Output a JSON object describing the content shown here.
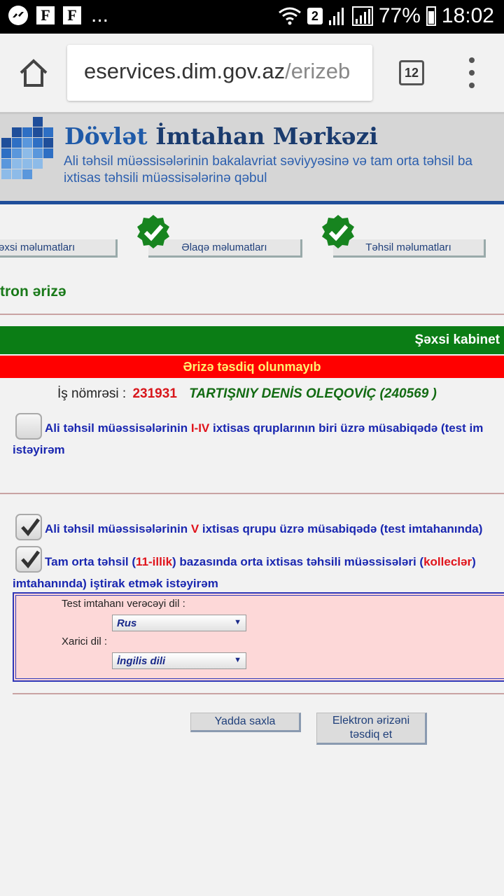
{
  "status_bar": {
    "notification_icons": [
      "messenger-icon",
      "flipboard-icon",
      "flipboard-icon"
    ],
    "more": "...",
    "sim_badge": "2",
    "battery": "77%",
    "time": "18:02"
  },
  "browser": {
    "url_host": "eservices.dim.gov.az",
    "url_path": "/erizeb",
    "tab_count": "12"
  },
  "banner": {
    "title_first": "Dövlət",
    "title_rest": " İmtahan Mərkəzi",
    "subtitle_line1": "Ali təhsil müəssisələrinin bakalavriat səviyyəsinə və tam orta təhsil ba",
    "subtitle_line2": "ixtisas təhsili müəssisələrinə qəbul",
    "logo_colors": [
      "#1f4e9a",
      "#2e6fc4",
      "#5a97dc",
      "#8dbbe8"
    ]
  },
  "steps": [
    {
      "label": "əxsi məlumatları",
      "done": false
    },
    {
      "label": "Əlaqə məlumatları",
      "done": true
    },
    {
      "label": "Təhsil məlumatları",
      "done": true
    }
  ],
  "section_title": "tron ərizə",
  "cabinet_link": "Şəxsi kabinet",
  "warning": "Ərizə təsdiq olunmayıb",
  "application": {
    "label": "İş nömrəsi :",
    "number": "231931",
    "name": "TARTIŞNIY DENİS OLEQOVİÇ (240569 )"
  },
  "option1": {
    "checked": false,
    "prefix": "Ali təhsil müəssisələrinin ",
    "highlight": "I-IV",
    "suffix": " ixtisas qruplarının biri üzrə müsabiqədə (test im",
    "line2": "istəyirəm"
  },
  "option2": {
    "checked": true,
    "prefix": "Ali təhsil müəssisələrinin ",
    "highlight": "V",
    "suffix": " ixtisas qrupu üzrə müsabiqədə (test imtahanında)"
  },
  "option3": {
    "checked": true,
    "prefix": "Tam orta təhsil (",
    "highlight1": "11-illik",
    "middle": ") bazasında orta ixtisas təhsili müəssisələri (",
    "highlight2": "kolleclər",
    "suffix": ")",
    "line2": "imtahanında) iştirak etmək istəyirəm"
  },
  "languages": {
    "test_label": "Test imtahanı verəcəyi dil :",
    "test_value": "Rus",
    "foreign_label": "Xarici dil :",
    "foreign_value": "İngilis dili"
  },
  "buttons": {
    "save": "Yadda saxla",
    "confirm_line1": "Elektron ərizəni",
    "confirm_line2": "təsdiq et"
  },
  "colors": {
    "cabinet_green": "#0b7d15",
    "warning_red": "#ff0000",
    "warning_text": "#ffef70",
    "link_blue": "#1a27b0"
  }
}
